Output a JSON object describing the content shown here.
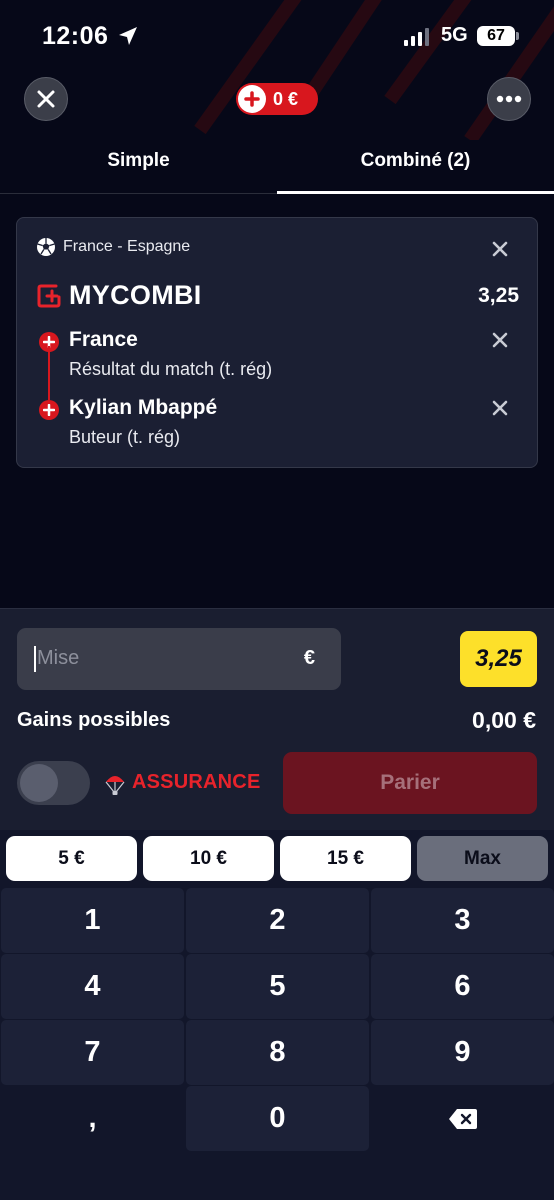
{
  "status_bar": {
    "time": "12:06",
    "network": "5G",
    "battery": "67"
  },
  "header": {
    "balance": "0 €"
  },
  "tabs": [
    {
      "label": "Simple"
    },
    {
      "label": "Combiné (2)"
    }
  ],
  "bet_card": {
    "event": "France - Espagne",
    "combi_title": "MYCOMBI",
    "combi_odds": "3,25",
    "selections": [
      {
        "name": "France",
        "market": "Résultat du match (t. rég)"
      },
      {
        "name": "Kylian Mbappé",
        "market": "Buteur (t. rég)"
      }
    ]
  },
  "bet_slip": {
    "stake_placeholder": "Mise",
    "currency": "€",
    "odds": "3,25",
    "gains_label": "Gains possibles",
    "gains_value": "0,00 €",
    "assurance_label": "ASSURANCE",
    "bet_button": "Parier"
  },
  "keypad": {
    "quick_amounts": [
      "5 €",
      "10 €",
      "15 €",
      "Max"
    ],
    "keys": [
      "1",
      "2",
      "3",
      "4",
      "5",
      "6",
      "7",
      "8",
      "9",
      ",",
      "0"
    ]
  },
  "colors": {
    "brand_red": "#d8171e",
    "odds_yellow": "#fde02a",
    "background": "#07091a"
  }
}
